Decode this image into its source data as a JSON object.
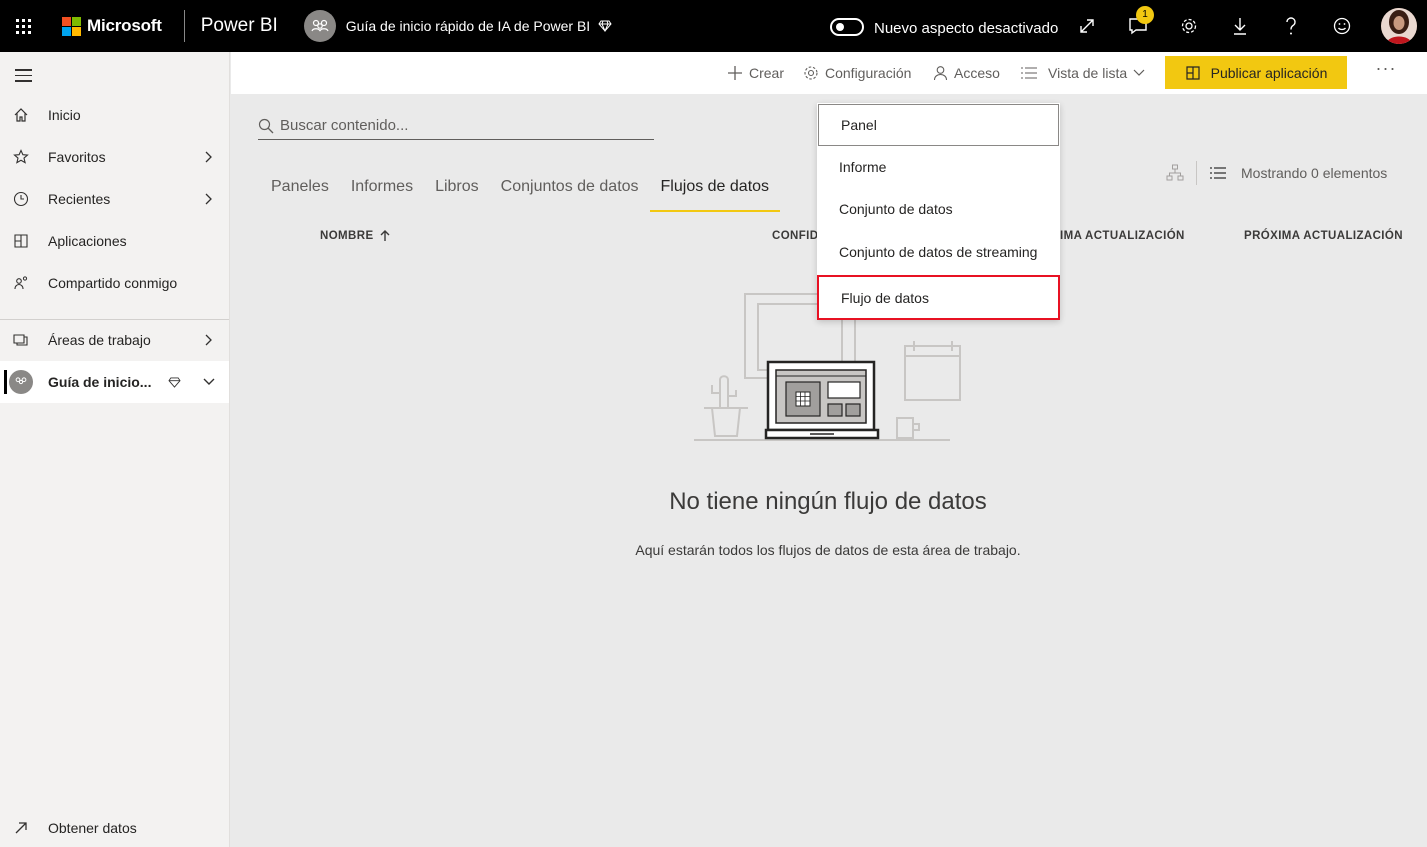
{
  "topbar": {
    "brand": "Microsoft",
    "product": "Power BI",
    "workspace_title": "Guía de inicio rápido de IA de Power BI",
    "toggle_label": "Nuevo aspecto desactivado",
    "notification_count": "1",
    "brand_colors": [
      "#f25022",
      "#7fba00",
      "#00a4ef",
      "#ffb900"
    ]
  },
  "sidebar": {
    "items": [
      {
        "label": "Inicio",
        "icon": "home-icon"
      },
      {
        "label": "Favoritos",
        "icon": "star-icon"
      },
      {
        "label": "Recientes",
        "icon": "clock-icon"
      },
      {
        "label": "Aplicaciones",
        "icon": "apps-icon"
      },
      {
        "label": "Compartido conmigo",
        "icon": "shared-icon"
      },
      {
        "label": "Áreas de trabajo",
        "icon": "workspaces-icon"
      },
      {
        "label": "Guía de inicio...",
        "icon": "workspace-avatar-icon"
      }
    ],
    "bottom": {
      "label": "Obtener datos",
      "icon": "arrow-up-right-icon"
    }
  },
  "commandbar": {
    "create": "Crear",
    "settings": "Configuración",
    "access": "Acceso",
    "view": "Vista de lista",
    "publish": "Publicar aplicación",
    "more": "···",
    "accent": "#f2c811"
  },
  "search": {
    "placeholder": "Buscar contenido..."
  },
  "tabs": [
    "Paneles",
    "Informes",
    "Libros",
    "Conjuntos de datos",
    "Flujos de datos"
  ],
  "active_tab": "Flujos de datos",
  "status": {
    "showing": "Mostrando 0 elementos"
  },
  "columns": {
    "name": "NOMBRE",
    "confidential": "CONFID",
    "last_refresh": "IMA ACTUALIZACIÓN",
    "next_refresh": "PRÓXIMA ACTUALIZACIÓN"
  },
  "empty": {
    "title": "No tiene ningún flujo de datos",
    "description": "Aquí estarán todos los flujos de datos de esta área de trabajo."
  },
  "dropdown": {
    "items": [
      "Panel",
      "Informe",
      "Conjunto de datos",
      "Conjunto de datos de streaming",
      "Flujo de datos"
    ],
    "highlight_color": "#e81123"
  }
}
